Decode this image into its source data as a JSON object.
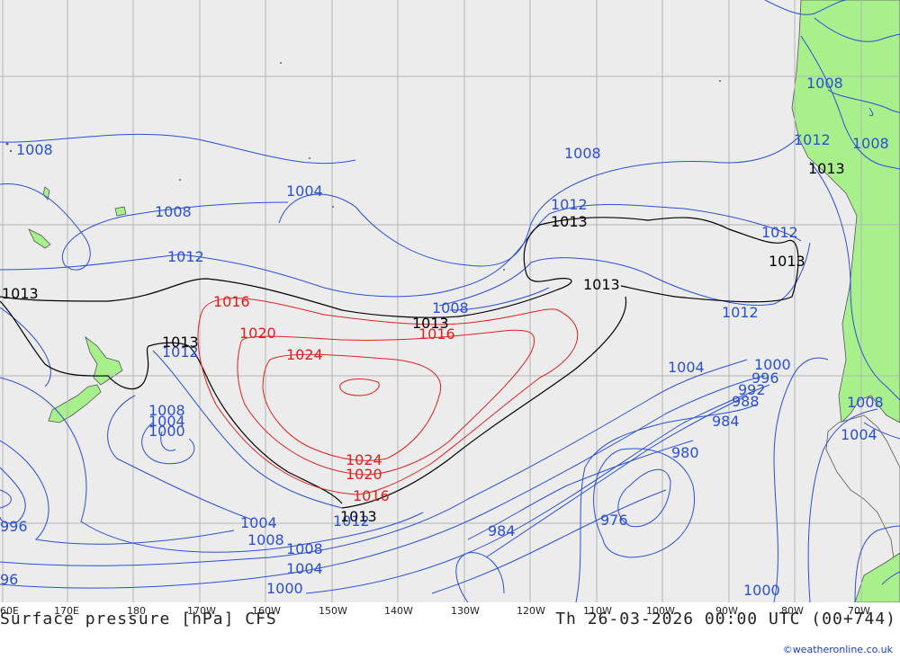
{
  "map": {
    "title": "Surface pressure [hPa] CFS",
    "valid_time": "Th 26-03-2026 00:00 UTC (00+744)",
    "credit": "©weatheronline.co.uk",
    "lon_ticks": [
      "60E",
      "170E",
      "180",
      "170W",
      "160W",
      "150W",
      "140W",
      "130W",
      "120W",
      "110W",
      "100W",
      "90W",
      "80W",
      "70W"
    ],
    "colors": {
      "ocean": "#ececec",
      "land": "#a8f08c",
      "grid": "#b4b4b4",
      "isobar_blue": "#2a4fd6",
      "isobar_red": "#e02020",
      "isobar_black": "#000000"
    },
    "isobar_labels": {
      "b1008_a": "1008",
      "b1008_b": "1008",
      "b1004_a": "1004",
      "b1008_c": "1008",
      "b1012_a": "1012",
      "b1012_b": "1012",
      "b1008_d": "1008",
      "b1012_c": "1012",
      "b1008_e": "1008",
      "b1012_d": "1012",
      "b1008_f": "1008",
      "b1012_e": "1012",
      "b1004_b": "1004",
      "b1000_a": "1000",
      "b996_a": "996",
      "b992_a": "992",
      "b988_a": "988",
      "b984_a": "984",
      "b980_a": "980",
      "b976_a": "976",
      "b984_b": "984",
      "b1008_g": "1008",
      "b1004_c": "1004",
      "b1000_b": "1000",
      "b1008_h": "1008",
      "b1004_d": "1004",
      "b1000_c": "1000",
      "b1012_f": "1012",
      "b996_b": "996",
      "b1004_e": "1004",
      "b1008_i": "1008",
      "b1008_j": "1008",
      "b1004_f": "1004",
      "b1000_d": "1000",
      "b996_c": "96",
      "b1012_g": "1012",
      "b1000_e": "1000",
      "b1008_k": "1008",
      "b1004_g": "1004",
      "k1013_a": "1013",
      "k1013_b": "1013",
      "k1013_c": "1013",
      "k1013_d": "1013",
      "k1013_e": "1013",
      "k1013_f": "1013",
      "k1013_g": "1013",
      "k1013_h": "1013",
      "r1016_a": "1016",
      "r1020_a": "1020",
      "r1024_a": "1024",
      "r1016_b": "1016",
      "r1024_b": "1024",
      "r1020_b": "1020",
      "r1016_c": "1016"
    }
  }
}
